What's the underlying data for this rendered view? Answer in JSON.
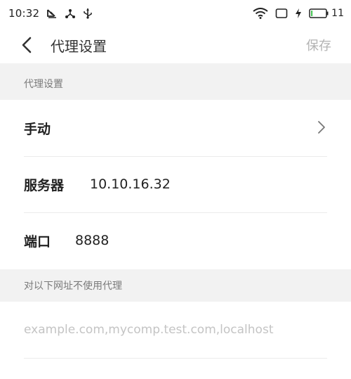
{
  "status_bar": {
    "time": "10:32",
    "battery_level": "11",
    "battery_fill_percent": 11
  },
  "title_bar": {
    "title": "代理设置",
    "save_label": "保存"
  },
  "proxy_section": {
    "header": "代理设置",
    "mode_label": "手动",
    "server_label": "服务器",
    "server_value": "10.10.16.32",
    "port_label": "端口",
    "port_value": "8888"
  },
  "bypass_section": {
    "header": "对以下网址不使用代理",
    "input_value": "",
    "input_placeholder": "example.com,mycomp.test.com,localhost"
  },
  "icons": {
    "back": "chevron-left-icon",
    "mode_chevron": "chevron-right-icon",
    "wifi": "wifi-icon",
    "battery": "battery-icon",
    "charging": "charging-bolt-icon"
  },
  "colors": {
    "background": "#f2f2f2",
    "surface": "#ffffff",
    "text_primary": "#222222",
    "text_secondary": "#7a7a7a",
    "save_disabled": "#b3b3b3",
    "placeholder": "#c4c4c4",
    "divider": "#ebebeb"
  }
}
